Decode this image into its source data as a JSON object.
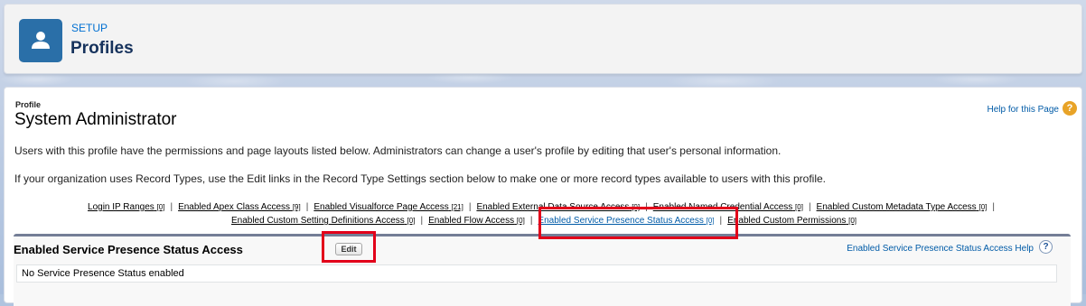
{
  "header": {
    "setup_label": "SETUP",
    "title": "Profiles"
  },
  "profile": {
    "label": "Profile",
    "name": "System Administrator",
    "help_link": "Help for this Page",
    "description_1": "Users with this profile have the permissions and page layouts listed below. Administrators can change a user's profile by editing that user's personal information.",
    "description_2": "If your organization uses Record Types, use the Edit links in the Record Type Settings section below to make one or more record types available to users with this profile."
  },
  "links_row1": [
    {
      "label": "Login IP Ranges",
      "count": "[0]"
    },
    {
      "label": "Enabled Apex Class Access",
      "count": "[9]"
    },
    {
      "label": "Enabled Visualforce Page Access",
      "count": "[21]"
    },
    {
      "label": "Enabled External Data Source Access",
      "count": "[0]"
    },
    {
      "label": "Enabled Named Credential Access",
      "count": "[0]"
    },
    {
      "label": "Enabled Custom Metadata Type Access",
      "count": "[0]"
    }
  ],
  "links_row2": [
    {
      "label": "Enabled Custom Setting Definitions Access",
      "count": "[0]"
    },
    {
      "label": "Enabled Flow Access",
      "count": "[0]"
    },
    {
      "label": "Enabled Service Presence Status Access",
      "count": "[0]"
    },
    {
      "label": "Enabled Custom Permissions",
      "count": "[0]"
    }
  ],
  "section": {
    "title": "Enabled Service Presence Status Access",
    "edit_label": "Edit",
    "help_link": "Enabled Service Presence Status Access Help",
    "empty_text": "No Service Presence Status enabled"
  },
  "icons": {
    "header": "user-profile-icon",
    "help": "question-mark-icon"
  },
  "colors": {
    "accent": "#2a6fa8",
    "link": "#015ba7",
    "highlight": "#e2001a"
  }
}
